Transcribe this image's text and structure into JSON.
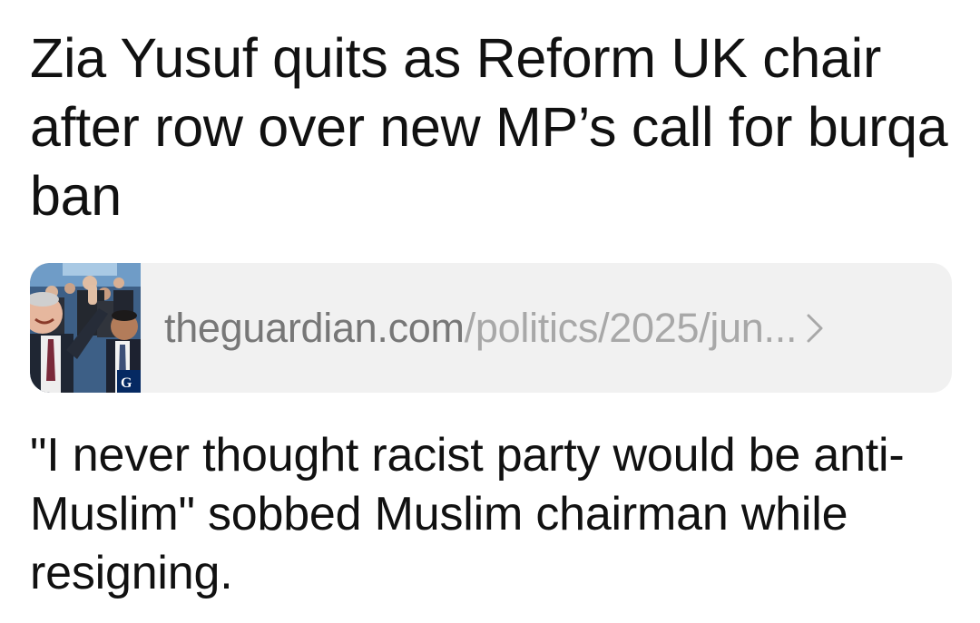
{
  "post": {
    "headline": "Zia Yusuf quits as Reform UK chair after row over new MP’s call for burqa ban",
    "link": {
      "domain": "theguardian.com",
      "path": "/politics/2025/jun...",
      "chevron_icon": "chevron-right-icon",
      "thumbnail_icon": "article-thumbnail-photo",
      "thumbnail_badge": "G"
    },
    "caption": "\"I never thought racist party would be anti-Muslim\" sobbed Muslim chairman while resigning."
  },
  "colors": {
    "text": "#111111",
    "card_background": "#f1f1f1",
    "link_domain": "#777777",
    "link_path": "#a8a8a8"
  }
}
